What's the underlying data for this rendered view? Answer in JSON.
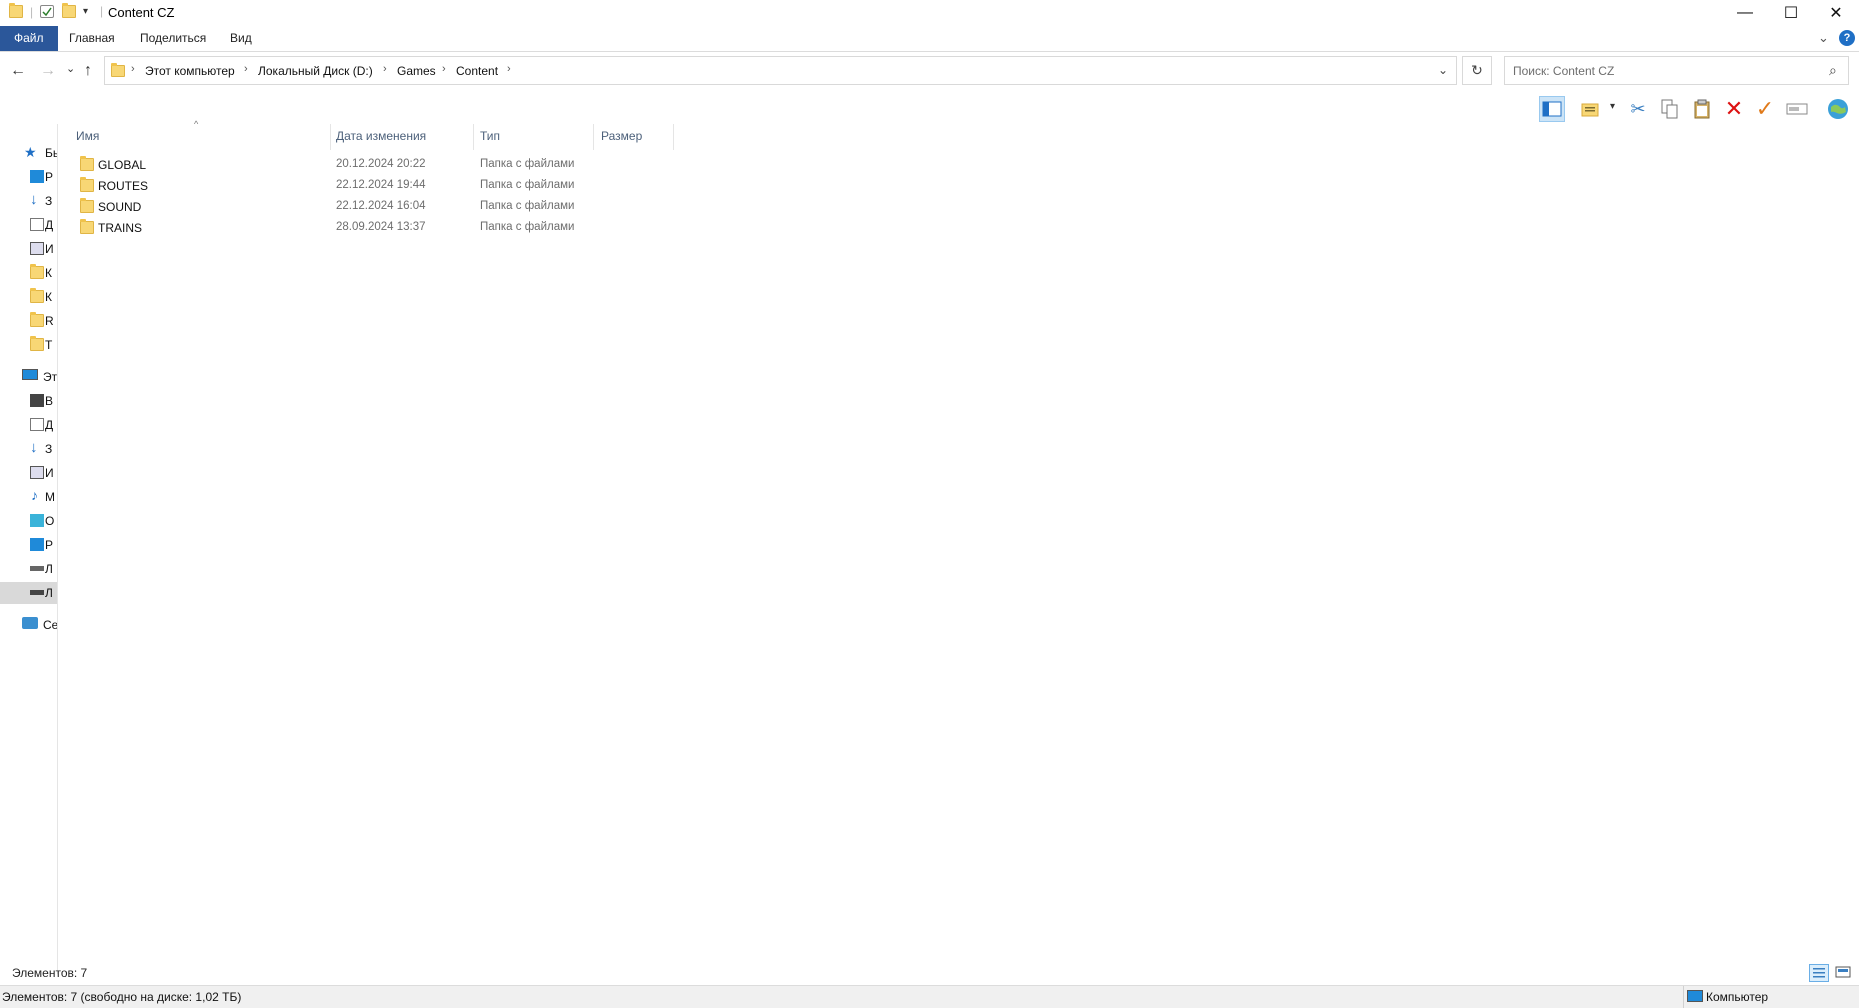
{
  "window": {
    "title": "Content CZ",
    "minimize_glyph": "—",
    "maximize_glyph": "☐",
    "close_glyph": "✕"
  },
  "ribbon": {
    "tabs": [
      "Файл",
      "Главная",
      "Поделиться",
      "Вид"
    ],
    "expand_glyph": "⌄",
    "help_glyph": "?"
  },
  "address": {
    "crumbs": [
      "Этот компьютер",
      "Локальный Диск (D:)",
      "Games",
      "Content"
    ],
    "sep": "›",
    "dropdown_glyph": "⌄",
    "refresh_glyph": "↻"
  },
  "search": {
    "placeholder": "Поиск: Content CZ",
    "icon_glyph": "⌕"
  },
  "nav": {
    "back_glyph": "←",
    "forward_glyph": "→",
    "recent_glyph": "⌄",
    "up_glyph": "↑"
  },
  "toolbar_icons": [
    "layout-pane-icon",
    "new-folder-icon",
    "cut-icon",
    "copy-icon",
    "paste-icon",
    "delete-icon",
    "apply-check-icon",
    "rename-icon",
    "globe-icon"
  ],
  "navpane": {
    "items": [
      {
        "text": "Бы",
        "icon": "star-icon"
      },
      {
        "text": "Р",
        "icon": "desktop-icon"
      },
      {
        "text": "З",
        "icon": "download-icon"
      },
      {
        "text": "Д",
        "icon": "document-icon"
      },
      {
        "text": "И",
        "icon": "image-icon"
      },
      {
        "text": "К",
        "icon": "folder-icon"
      },
      {
        "text": "К",
        "icon": "folder-icon"
      },
      {
        "text": "R",
        "icon": "folder-icon"
      },
      {
        "text": "T",
        "icon": "folder-icon"
      },
      {
        "text": "Эт",
        "icon": "computer-icon"
      },
      {
        "text": "В",
        "icon": "video-icon"
      },
      {
        "text": "Д",
        "icon": "document-icon"
      },
      {
        "text": "З",
        "icon": "download-icon"
      },
      {
        "text": "И",
        "icon": "image-icon"
      },
      {
        "text": "М",
        "icon": "music-icon"
      },
      {
        "text": "О",
        "icon": "3d-objects-icon"
      },
      {
        "text": "Р",
        "icon": "desktop-icon"
      },
      {
        "text": "Л",
        "icon": "drive-icon"
      },
      {
        "text": "Л",
        "icon": "drive-selected-icon"
      },
      {
        "text": "Се",
        "icon": "network-icon"
      }
    ]
  },
  "columns": {
    "name": "Имя",
    "date": "Дата изменения",
    "type": "Тип",
    "size": "Размер"
  },
  "files": [
    {
      "name": "GLOBAL",
      "date": "20.12.2024 20:22",
      "type": "Папка с файлами"
    },
    {
      "name": "ROUTES",
      "date": "22.12.2024 19:44",
      "type": "Папка с файлами"
    },
    {
      "name": "SOUND",
      "date": "22.12.2024 16:04",
      "type": "Папка с файлами"
    },
    {
      "name": "TRAINS",
      "date": "28.09.2024 13:37",
      "type": "Папка с файлами"
    }
  ],
  "status": {
    "count": "Элементов: 7",
    "disk": "Элементов: 7 (свободно на диске: 1,02 ТБ)",
    "zone": "Компьютер"
  }
}
